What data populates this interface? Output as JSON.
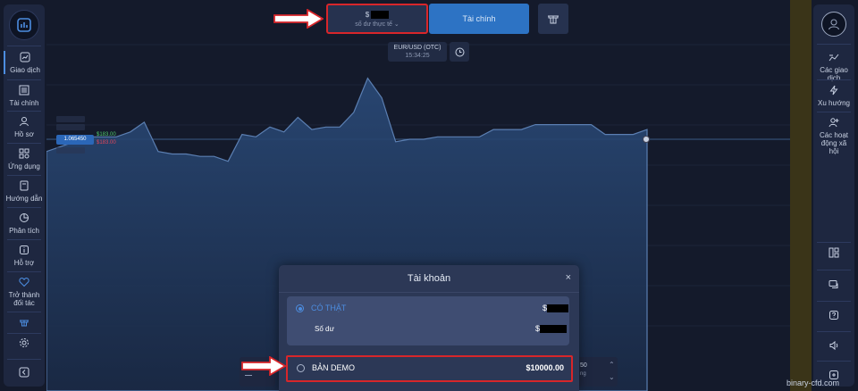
{
  "top_bar": {
    "balance_currency": "$",
    "balance_label": "số dư thực tế",
    "finance_button": "Tài chính"
  },
  "asset": {
    "pair": "EUR/USD (OTC)",
    "time": "15:34:25"
  },
  "price": {
    "current": "1.065450",
    "up_payout": "$183.00",
    "down_payout": "$183.00"
  },
  "left_sidebar": {
    "items": [
      {
        "label": "Giao dịch",
        "icon": "chart-icon"
      },
      {
        "label": "Tài chính",
        "icon": "bank-icon"
      },
      {
        "label": "Hồ sơ",
        "icon": "user-icon"
      },
      {
        "label": "Ứng dụng",
        "icon": "apps-icon"
      },
      {
        "label": "Hướng dẫn",
        "icon": "book-icon"
      },
      {
        "label": "Phân tích",
        "icon": "pie-chart-icon"
      },
      {
        "label": "Hỗ trợ",
        "icon": "info-icon"
      },
      {
        "label": "Trở thành đối tác",
        "icon": "heart-icon"
      }
    ]
  },
  "right_sidebar": {
    "items": [
      {
        "label": "Các giao dịch",
        "icon": "trades-icon"
      },
      {
        "label": "Xu hướng",
        "icon": "bolt-icon"
      },
      {
        "label": "Các hoạt động xã hội",
        "icon": "social-icon"
      }
    ]
  },
  "modal": {
    "title": "Tài khoản",
    "close": "×",
    "real": {
      "label": "CÓ THẬT",
      "amount_currency": "$",
      "balance_label": "Số dư",
      "balance_currency": "$"
    },
    "demo": {
      "label": "BẢN DEMO",
      "amount": "$10000.00"
    }
  },
  "bottom": {
    "partial_value": "50",
    "partial_label": "ng"
  },
  "watermark": "binary-cfd.com",
  "colors": {
    "accent": "#2d73c4",
    "highlight": "#d8262a",
    "up": "#4fc96b",
    "down": "#e0465a"
  },
  "chart_data": {
    "type": "area",
    "series": [
      {
        "values": [
          0.62,
          0.6,
          0.58,
          0.56,
          0.56,
          0.56,
          0.54,
          0.5,
          0.62,
          0.63,
          0.63,
          0.64,
          0.64,
          0.66,
          0.55,
          0.56,
          0.52,
          0.54,
          0.48,
          0.53,
          0.52,
          0.52,
          0.46,
          0.32,
          0.4,
          0.58,
          0.57,
          0.57,
          0.56,
          0.56,
          0.56,
          0.56,
          0.53,
          0.53,
          0.53,
          0.51,
          0.51,
          0.51,
          0.51,
          0.51,
          0.55,
          0.55,
          0.55,
          0.53
        ]
      }
    ]
  }
}
